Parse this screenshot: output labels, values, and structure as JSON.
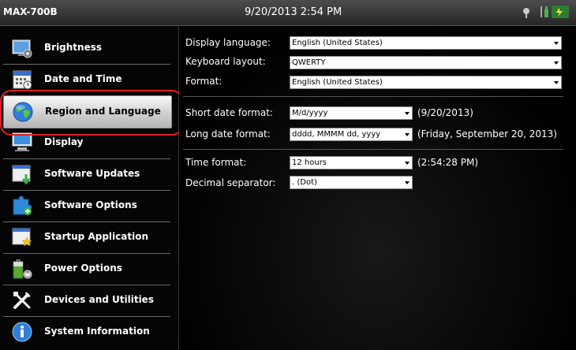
{
  "titlebar": {
    "model": "MAX-700B",
    "datetime": "9/20/2013 2:54 PM"
  },
  "sidebar": {
    "items": [
      {
        "label": "Brightness",
        "icon": "brightness-icon"
      },
      {
        "label": "Date and Time",
        "icon": "calendar-icon"
      },
      {
        "label": "Region and Language",
        "icon": "globe-icon",
        "selected": true
      },
      {
        "label": "Display",
        "icon": "display-icon"
      },
      {
        "label": "Software Updates",
        "icon": "software-updates-icon"
      },
      {
        "label": "Software Options",
        "icon": "puzzle-icon"
      },
      {
        "label": "Startup Application",
        "icon": "startup-star-icon"
      },
      {
        "label": "Power Options",
        "icon": "battery-plug-icon"
      },
      {
        "label": "Devices and Utilities",
        "icon": "tools-icon"
      },
      {
        "label": "System Information",
        "icon": "info-icon"
      }
    ]
  },
  "region": {
    "display_language": {
      "label": "Display language:",
      "value": "English (United States)"
    },
    "keyboard_layout": {
      "label": "Keyboard layout:",
      "value": "QWERTY"
    },
    "format": {
      "label": "Format:",
      "value": "English (United States)"
    },
    "short_date": {
      "label": "Short date format:",
      "value": "M/d/yyyy",
      "sample": "(9/20/2013)"
    },
    "long_date": {
      "label": "Long date format:",
      "value": "dddd, MMMM dd, yyyy",
      "sample": "(Friday, September 20, 2013)"
    },
    "time_format": {
      "label": "Time format:",
      "value": "12 hours",
      "sample": "(2:54:28 PM)"
    },
    "decimal_separator": {
      "label": "Decimal separator:",
      "value": ". (Dot)"
    }
  },
  "colors": {
    "highlight": "#e02020",
    "selected_bg": "#e6e6e6",
    "background": "#000000"
  }
}
